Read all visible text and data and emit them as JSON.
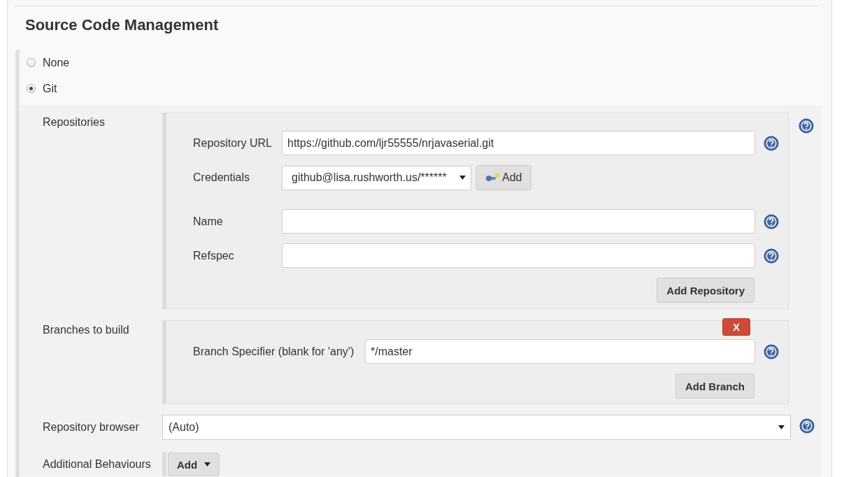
{
  "section": {
    "title": "Source Code Management"
  },
  "scm_options": [
    {
      "label": "None",
      "selected": false
    },
    {
      "label": "Git",
      "selected": true
    }
  ],
  "repositories": {
    "label": "Repositories",
    "fields": [
      {
        "label": "Repository URL",
        "kind": "text",
        "value": "https://github.com/ljr55555/nrjavaserial.git"
      },
      {
        "label": "Credentials",
        "kind": "select",
        "value": "github@lisa.rushworth.us/******",
        "add_button": "Add"
      },
      {
        "label": "Name",
        "kind": "text"
      },
      {
        "label": "Refspec",
        "kind": "text"
      }
    ],
    "add_button": "Add Repository"
  },
  "branches": {
    "label": "Branches to build",
    "delete_button": "X",
    "specifier_label": "Branch Specifier (blank for 'any')",
    "specifier_value": "*/master",
    "add_button": "Add Branch"
  },
  "repository_browser": {
    "label": "Repository browser",
    "value": "(Auto)"
  },
  "additional_behaviours": {
    "label": "Additional Behaviours",
    "add_button": "Add"
  }
}
